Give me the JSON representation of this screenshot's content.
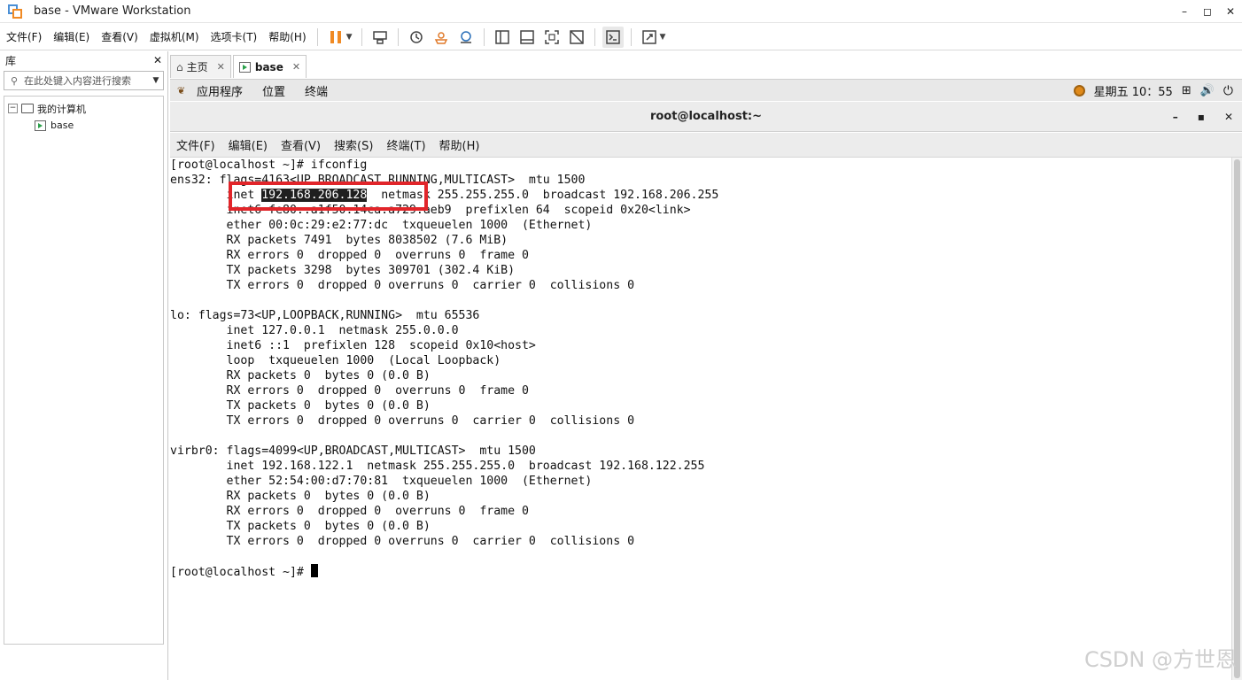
{
  "window": {
    "title": "base - VMware Workstation",
    "controls": [
      "–",
      "◻",
      "✕"
    ]
  },
  "menu": {
    "items": [
      "文件(F)",
      "编辑(E)",
      "查看(V)",
      "虚拟机(M)",
      "选项卡(T)",
      "帮助(H)"
    ]
  },
  "library": {
    "title": "库",
    "close": "✕",
    "search_placeholder": "在此处键入内容进行搜索",
    "tree": {
      "root": "我的计算机",
      "child": "base"
    }
  },
  "tabs": [
    {
      "label": "主页",
      "close": "✕"
    },
    {
      "label": "base",
      "close": "✕"
    }
  ],
  "guest_bar": {
    "apps": "应用程序",
    "places": "位置",
    "terminal": "终端",
    "datetime": "星期五 10：55"
  },
  "terminal_window": {
    "title": "root@localhost:~",
    "menu": [
      "文件(F)",
      "编辑(E)",
      "查看(V)",
      "搜索(S)",
      "终端(T)",
      "帮助(H)"
    ],
    "controls": [
      "–",
      "▪",
      "✕"
    ]
  },
  "terminal": {
    "lines": [
      "[root@localhost ~]# ifconfig",
      "ens32: flags=4163<UP,BROADCAST,RUNNING,MULTICAST>  mtu 1500",
      "        inet ",
      "        inet6 fe80::a1f50:14ca:a729:aeb9  prefixlen 64  scopeid 0x20<link>",
      "        ether 00:0c:29:e2:77:dc  txqueuelen 1000  (Ethernet)",
      "        RX packets 7491  bytes 8038502 (7.6 MiB)",
      "        RX errors 0  dropped 0  overruns 0  frame 0",
      "        TX packets 3298  bytes 309701 (302.4 KiB)",
      "        TX errors 0  dropped 0 overruns 0  carrier 0  collisions 0",
      "",
      "lo: flags=73<UP,LOOPBACK,RUNNING>  mtu 65536",
      "        inet 127.0.0.1  netmask 255.0.0.0",
      "        inet6 ::1  prefixlen 128  scopeid 0x10<host>",
      "        loop  txqueuelen 1000  (Local Loopback)",
      "        RX packets 0  bytes 0 (0.0 B)",
      "        RX errors 0  dropped 0  overruns 0  frame 0",
      "        TX packets 0  bytes 0 (0.0 B)",
      "        TX errors 0  dropped 0 overruns 0  carrier 0  collisions 0",
      "",
      "virbr0: flags=4099<UP,BROADCAST,MULTICAST>  mtu 1500",
      "        inet 192.168.122.1  netmask 255.255.255.0  broadcast 192.168.122.255",
      "        ether 52:54:00:d7:70:81  txqueuelen 1000  (Ethernet)",
      "        RX packets 0  bytes 0 (0.0 B)",
      "        RX errors 0  dropped 0  overruns 0  frame 0",
      "        TX packets 0  bytes 0 (0.0 B)",
      "        TX errors 0  dropped 0 overruns 0  carrier 0  collisions 0",
      "",
      "[root@localhost ~]# "
    ],
    "selected_ip": "192.168.206.128",
    "after_ip": "  netmask 255.255.255.0  broadcast 192.168.206.255"
  },
  "watermark": "CSDN @方世恩",
  "colors": {
    "highlight_box": "#e1252a",
    "selection_bg": "#1f1f1f"
  }
}
